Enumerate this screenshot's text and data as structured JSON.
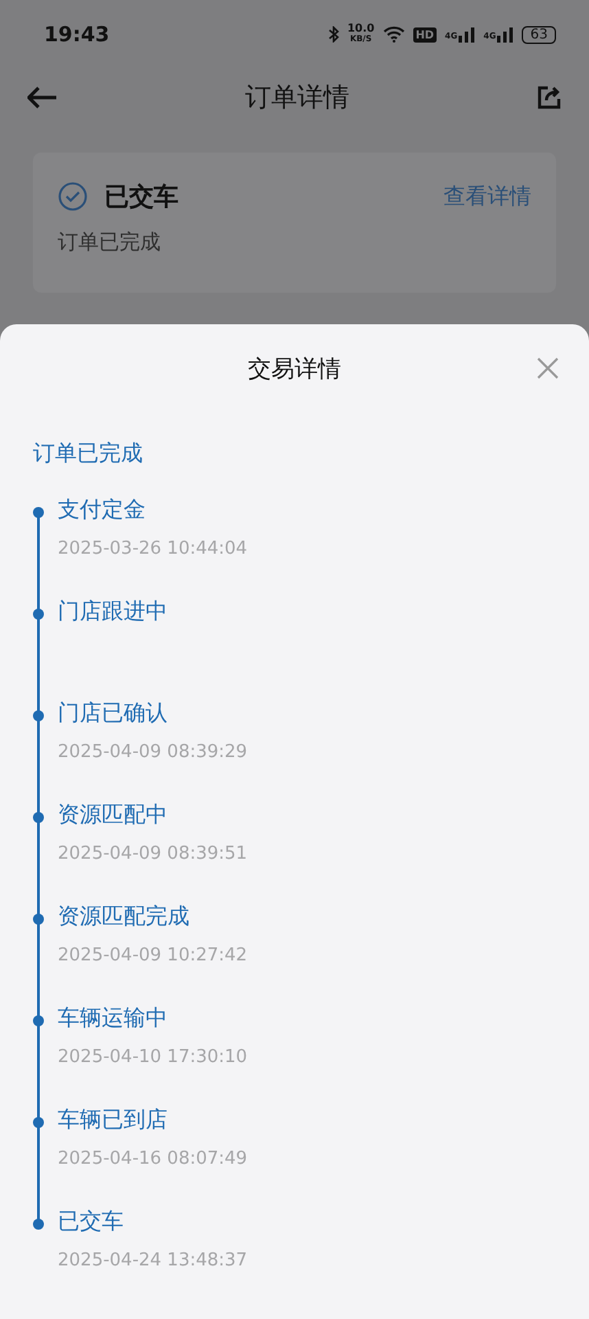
{
  "status_bar": {
    "time": "19:43",
    "speed": "10.0",
    "speed_unit": "KB/S",
    "hd": "HD",
    "network_1": "4G",
    "network_2": "4G",
    "battery": "63"
  },
  "header": {
    "title": "订单详情"
  },
  "order_card": {
    "status": "已交车",
    "link": "查看详情",
    "subtitle": "订单已完成"
  },
  "sheet": {
    "title": "交易详情",
    "summary": "订单已完成",
    "steps": [
      {
        "title": "支付定金",
        "time": "2025-03-26 10:44:04"
      },
      {
        "title": "门店跟进中"
      },
      {
        "title": "门店已确认",
        "time": "2025-04-09 08:39:29"
      },
      {
        "title": "资源匹配中",
        "time": "2025-04-09 08:39:51"
      },
      {
        "title": "资源匹配完成",
        "time": "2025-04-09 10:27:42"
      },
      {
        "title": "车辆运输中",
        "time": "2025-04-10 17:30:10"
      },
      {
        "title": "车辆已到店",
        "time": "2025-04-16 08:07:49"
      },
      {
        "title": "已交车",
        "time": "2025-04-24 13:48:37"
      }
    ]
  }
}
